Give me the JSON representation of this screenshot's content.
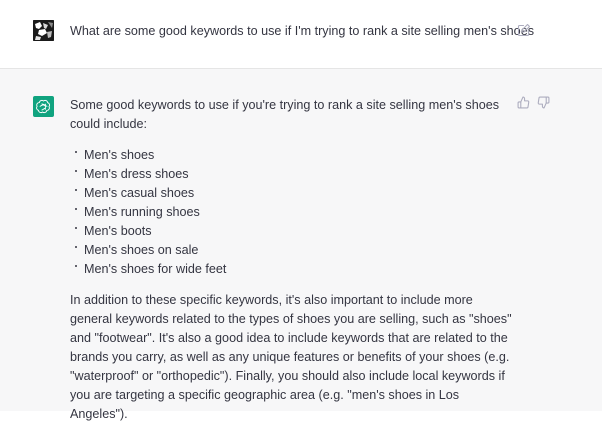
{
  "user_message": {
    "text": "What are some good keywords to use if I'm trying to rank a site selling men's shoes"
  },
  "assistant_message": {
    "intro": "Some good keywords to use if you're trying to rank a site selling men's shoes could include:",
    "keywords": [
      "Men's shoes",
      "Men's dress shoes",
      "Men's casual shoes",
      "Men's running shoes",
      "Men's boots",
      "Men's shoes on sale",
      "Men's shoes for wide feet"
    ],
    "paragraph": "In addition to these specific keywords, it's also important to include more general keywords related to the types of shoes you are selling, such as \"shoes\" and \"footwear\". It's also a good idea to include keywords that are related to the brands you carry, as well as any unique features or benefits of your shoes (e.g. \"waterproof\" or \"orthopedic\"). Finally, you should also include local keywords if you are targeting a specific geographic area (e.g. \"men's shoes in Los Angeles\")."
  },
  "colors": {
    "accent": "#10a37f",
    "text": "#343541",
    "assistant_bg": "#f7f7f8",
    "icon": "#acacbe"
  },
  "icons": {
    "edit": "edit-icon",
    "thumbs_up": "thumbs-up-icon",
    "thumbs_down": "thumbs-down-icon",
    "bot": "openai-logo-icon"
  }
}
